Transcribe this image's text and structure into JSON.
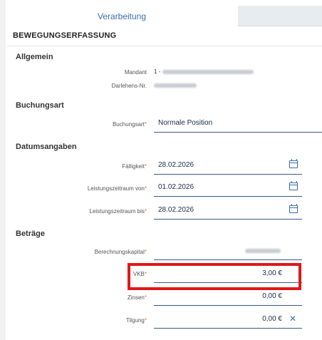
{
  "tabs": {
    "active": "Verarbeitung"
  },
  "page_title": "BEWEGUNGSERFASSUNG",
  "sections": {
    "allgemein": "Allgemein",
    "buchungsart": "Buchungsart",
    "datum": "Datumsangaben",
    "betraege": "Beträge"
  },
  "fields": {
    "mandant": {
      "label": "Mandant",
      "value": "1 -"
    },
    "darlehen": {
      "label": "Darlehens-Nr."
    },
    "buchungsart": {
      "label": "Buchungsart",
      "value": "Normale Position"
    },
    "faelligkeit": {
      "label": "Fälligkeit",
      "value": "28.02.2026"
    },
    "leistung_von": {
      "label": "Leistungszeitraum von",
      "value": "01.02.2026"
    },
    "leistung_bis": {
      "label": "Leistungszeitraum bis",
      "value": "28.02.2026"
    },
    "berechnungskapital": {
      "label": "Berechnungskapital"
    },
    "vkb": {
      "label": "VKB",
      "value": "3,00 €"
    },
    "zinsen": {
      "label": "Zinsen",
      "value": "0,00 €"
    },
    "tilgung": {
      "label": "Tilgung",
      "value": "0,00 €"
    }
  },
  "required_mark": "*",
  "icons": {
    "date": "calendar-icon",
    "clear": "clear-icon"
  }
}
